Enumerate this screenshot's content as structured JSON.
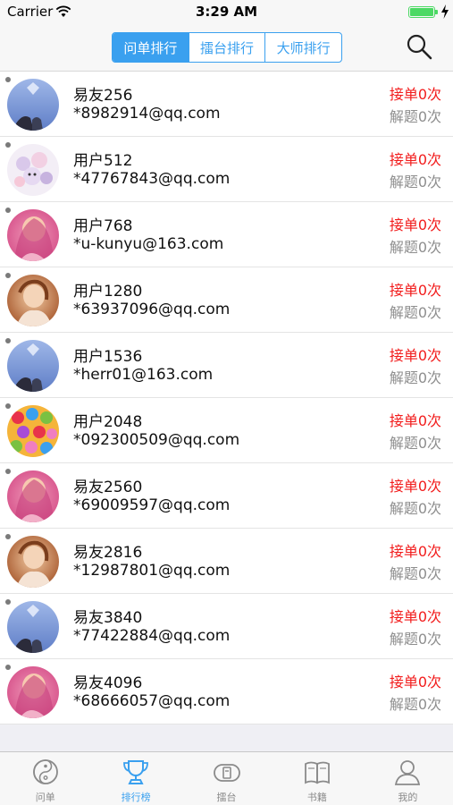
{
  "status": {
    "carrier": "Carrier",
    "time": "3:29 AM",
    "battery_level": 1.0
  },
  "nav": {
    "segments": [
      "问单排行",
      "擂台排行",
      "大师排行"
    ],
    "selected_index": 0,
    "search_icon": "search-icon"
  },
  "colors": {
    "accent": "#3aa0ef",
    "accept_red": "#f21c1c",
    "muted_gray": "#8e8e8e"
  },
  "list": [
    {
      "name": "易友256",
      "email": "*8982914@qq.com",
      "accept": "接单0次",
      "solve": "解题0次",
      "avatar": "avatar-sky-photo"
    },
    {
      "name": "用户512",
      "email": "*47767843@qq.com",
      "accept": "接单0次",
      "solve": "解题0次",
      "avatar": "avatar-cartoon-photo"
    },
    {
      "name": "用户768",
      "email": "*u-kunyu@163.com",
      "accept": "接单0次",
      "solve": "解题0次",
      "avatar": "avatar-pink-photo"
    },
    {
      "name": "用户1280",
      "email": "*63937096@qq.com",
      "accept": "接单0次",
      "solve": "解题0次",
      "avatar": "avatar-warm-photo"
    },
    {
      "name": "用户1536",
      "email": "*herr01@163.com",
      "accept": "接单0次",
      "solve": "解题0次",
      "avatar": "avatar-sky-photo"
    },
    {
      "name": "用户2048",
      "email": "*092300509@qq.com",
      "accept": "接单0次",
      "solve": "解题0次",
      "avatar": "avatar-candy-photo"
    },
    {
      "name": "易友2560",
      "email": "*69009597@qq.com",
      "accept": "接单0次",
      "solve": "解题0次",
      "avatar": "avatar-pink-photo"
    },
    {
      "name": "易友2816",
      "email": "*12987801@qq.com",
      "accept": "接单0次",
      "solve": "解题0次",
      "avatar": "avatar-warm-photo"
    },
    {
      "name": "易友3840",
      "email": "*77422884@qq.com",
      "accept": "接单0次",
      "solve": "解题0次",
      "avatar": "avatar-sky-photo"
    },
    {
      "name": "易友4096",
      "email": "*68666057@qq.com",
      "accept": "接单0次",
      "solve": "解题0次",
      "avatar": "avatar-pink-photo"
    }
  ],
  "tabbar": {
    "selected_index": 1,
    "tabs": [
      {
        "label": "问单",
        "icon": "yin-yang-icon"
      },
      {
        "label": "排行榜",
        "icon": "trophy-icon"
      },
      {
        "label": "擂台",
        "icon": "arena-icon"
      },
      {
        "label": "书籍",
        "icon": "book-icon"
      },
      {
        "label": "我的",
        "icon": "person-icon"
      }
    ]
  }
}
